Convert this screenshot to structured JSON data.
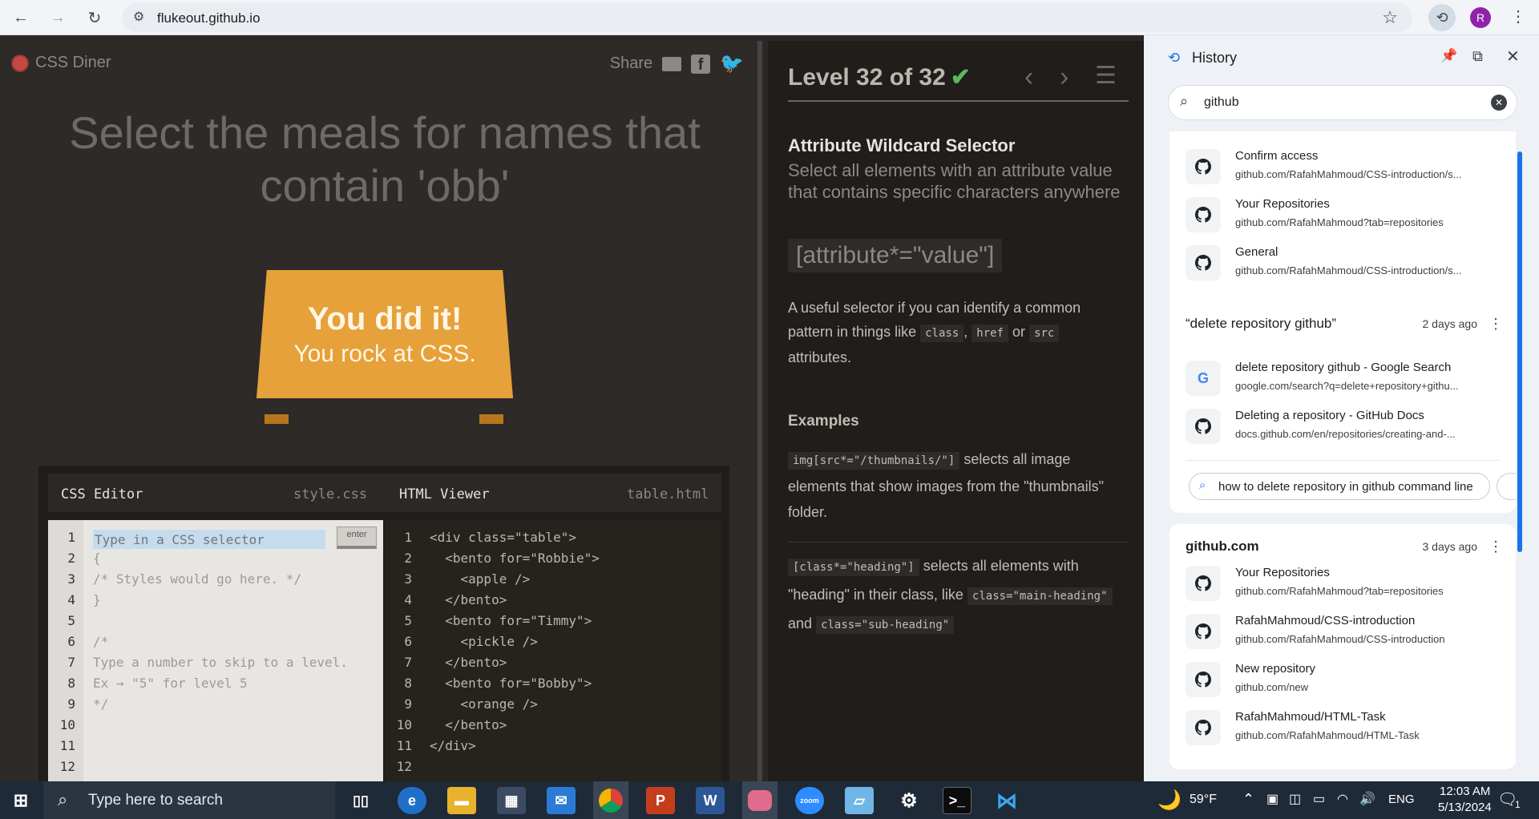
{
  "browser": {
    "url": "flukeout.github.io",
    "profile_initial": "R"
  },
  "diner": {
    "brand": "CSS Diner",
    "share_label": "Share",
    "instruction": "Select the meals for names that contain 'obb'",
    "plate_message_top": "You did it!",
    "plate_message_bottom": "You rock at CSS.",
    "css_editor_title": "CSS Editor",
    "css_editor_file": "style.css",
    "html_viewer_title": "HTML Viewer",
    "html_viewer_file": "table.html",
    "css_input_placeholder": "Type in a CSS selector",
    "enter_label": "enter",
    "css_lines": [
      "",
      "{",
      "/* Styles would go here. */",
      "}",
      "",
      "/*",
      "Type a number to skip to a level.",
      "Ex → \"5\" for level 5",
      "*/",
      "",
      "",
      ""
    ],
    "html_lines": [
      "<div class=\"table\">",
      "  <bento for=\"Robbie\">",
      "    <apple />",
      "  </bento>",
      "  <bento for=\"Timmy\">",
      "    <pickle />",
      "  </bento>",
      "  <bento for=\"Bobby\">",
      "    <orange />",
      "  </bento>",
      "</div>",
      ""
    ],
    "line_numbers": [
      "1",
      "2",
      "3",
      "4",
      "5",
      "6",
      "7",
      "8",
      "9",
      "10",
      "11",
      "12"
    ]
  },
  "sidebar": {
    "level_label": "Level 32 of 32",
    "level_check": "✔",
    "selector_name": "Attribute Wildcard Selector",
    "selector_title": "Select all elements with an attribute value that contains specific characters anywhere",
    "syntax": "[attribute*=\"value\"]",
    "hint_prefix": "A useful selector if you can identify a common pattern in things like",
    "hint_code_1": "class",
    "hint_sep": ",",
    "hint_code_2": "href",
    "hint_or": "or",
    "hint_code_3": "src",
    "hint_suffix": "attributes.",
    "examples_heading": "Examples",
    "example1_code": "img[src*=\"/thumbnails/\"]",
    "example1_text": "selects all image elements that show images from the \"thumbnails\" folder.",
    "example2_code": "[class*=\"heading\"]",
    "example2_text": "selects all elements with \"heading\" in their class, like",
    "example2_code2": "class=\"main-heading\"",
    "example2_and": "and",
    "example2_code3": "class=\"sub-heading\""
  },
  "history_panel": {
    "title": "History",
    "search_value": "github",
    "group1_rows": [
      {
        "title": "Confirm access",
        "url": "github.com/RafahMahmoud/CSS-introduction/s..."
      },
      {
        "title": "Your Repositories",
        "url": "github.com/RafahMahmoud?tab=repositories"
      },
      {
        "title": "General",
        "url": "github.com/RafahMahmoud/CSS-introduction/s..."
      }
    ],
    "group2_title": "“delete repository github”",
    "group2_time": "2 days ago",
    "group2_rows": [
      {
        "title": "delete repository github - Google Search",
        "url": "google.com/search?q=delete+repository+githu..."
      },
      {
        "title": "Deleting a repository - GitHub Docs",
        "url": "docs.github.com/en/repositories/creating-and-..."
      }
    ],
    "group2_chip": "how to delete repository in github command line",
    "group3_title": "github.com",
    "group3_time": "3 days ago",
    "group3_rows": [
      {
        "title": "Your Repositories",
        "url": "github.com/RafahMahmoud?tab=repositories"
      },
      {
        "title": "RafahMahmoud/CSS-introduction",
        "url": "github.com/RafahMahmoud/CSS-introduction"
      },
      {
        "title": "New repository",
        "url": "github.com/new"
      },
      {
        "title": "RafahMahmoud/HTML-Task",
        "url": "github.com/RafahMahmoud/HTML-Task"
      }
    ]
  },
  "taskbar": {
    "search_placeholder": "Type here to search",
    "temperature": "59°F",
    "language": "ENG",
    "time": "12:03 AM",
    "date": "5/13/2024",
    "notification_count": "1"
  }
}
